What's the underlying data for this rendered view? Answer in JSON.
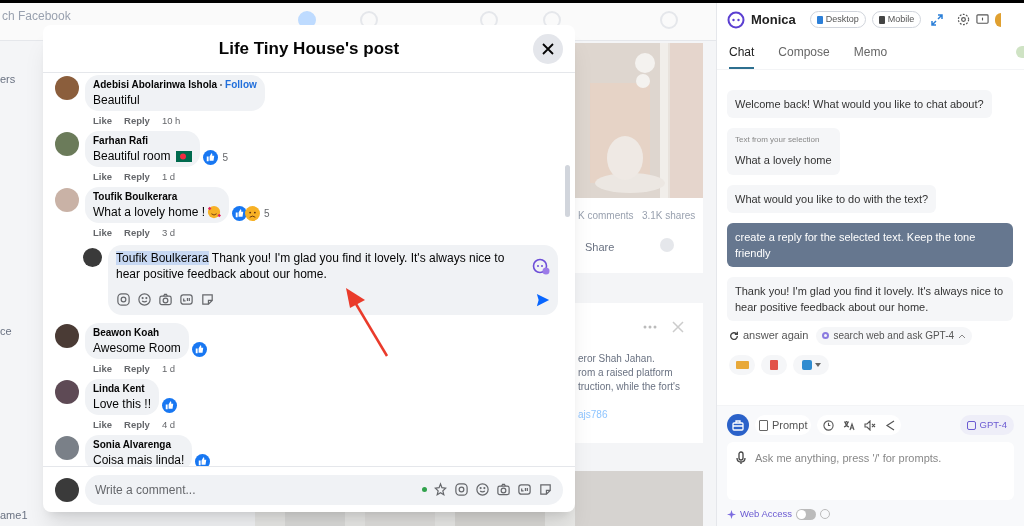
{
  "background": {
    "search_text": "ch Facebook",
    "sidebar_texts": [
      "ers",
      "ce",
      "ame1"
    ],
    "stats": "K comments   3.1K shares",
    "share": "Share",
    "post_lines": [
      "eror Shah Jahan.",
      "rom a raised platform",
      "truction, while the fort's"
    ],
    "post_link": "ajs786"
  },
  "modal": {
    "title": "Life Tiny House's post",
    "comments": [
      {
        "name": "Adebisi Abolarinwa Ishola",
        "follow": "Follow",
        "text": "Beautiful",
        "actions": [
          "Like",
          "Reply"
        ],
        "time": "10 h"
      },
      {
        "name": "Farhan Rafi",
        "text": "Beautiful room",
        "emoji": {
          "kind": "flag"
        },
        "reactions": [
          {
            "kind": "like"
          }
        ],
        "count": "5",
        "actions": [
          "Like",
          "Reply"
        ],
        "time": "1 d"
      },
      {
        "name": "Toufik Boulkerara",
        "text": "What a lovely home !",
        "emoji": {
          "kind": "hearts"
        },
        "reactions": [
          {
            "kind": "like"
          },
          {
            "kind": "sad"
          }
        ],
        "count": "5",
        "actions": [
          "Like",
          "Reply"
        ],
        "time": "3 d",
        "reply_box": {
          "mention": "Toufik Boulkerara",
          "text": "Thank you! I'm glad you find it lovely. It's always nice to hear positive feedback about our home."
        }
      },
      {
        "name": "Beawon Koah",
        "text": "Awesome Room",
        "reactions": [
          {
            "kind": "like"
          }
        ],
        "actions": [
          "Like",
          "Reply"
        ],
        "time": "1 d"
      },
      {
        "name": "Linda Kent",
        "text": "Love this !!",
        "reactions": [
          {
            "kind": "like"
          }
        ],
        "actions": [
          "Like",
          "Reply"
        ],
        "time": "4 d"
      },
      {
        "name": "Sonia Alvarenga",
        "text": "Coisa mais linda!",
        "reactions": [
          {
            "kind": "like"
          }
        ]
      }
    ],
    "composer": {
      "placeholder": "Write a comment..."
    }
  },
  "monica": {
    "title": "Monica",
    "chips": [
      "Desktop",
      "Mobile"
    ],
    "tabs": [
      {
        "label": "Chat",
        "selected": true
      },
      {
        "label": "Compose",
        "selected": false
      },
      {
        "label": "Memo",
        "selected": false
      }
    ],
    "side_toggle": {
      "on": true
    },
    "messages": [
      {
        "kind": "bot",
        "text": "Welcome back! What would you like to chat about?"
      },
      {
        "kind": "selection",
        "caption": "Text from your selection",
        "text": "What a lovely home"
      },
      {
        "kind": "bot",
        "text": "What would you like to do with the text?"
      },
      {
        "kind": "user",
        "text": "create a reply for the selected text. Keep the tone friendly"
      },
      {
        "kind": "bot",
        "text": "Thank you! I'm glad you find it lovely. It's always nice to hear positive feedback about our home."
      }
    ],
    "answer_again": "answer again",
    "search_web": "search web and ask GPT-4",
    "prompt_button": "Prompt",
    "model": "GPT-4",
    "input": {
      "placeholder": "Ask me anything, press '/' for prompts."
    },
    "web_access": {
      "label": "Web Access",
      "on": false
    }
  }
}
